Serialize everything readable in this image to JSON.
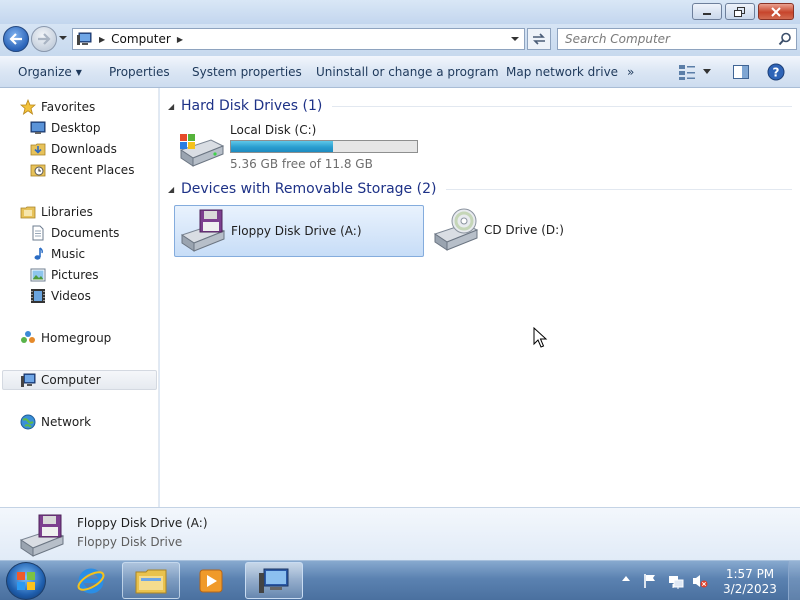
{
  "window": {
    "buttons": [
      "minimize-icon",
      "restore-icon",
      "close-icon"
    ]
  },
  "address": {
    "crumbs": [
      "Computer"
    ],
    "search_placeholder": "Search Computer"
  },
  "toolbar": {
    "organize": "Organize",
    "properties": "Properties",
    "system_properties": "System properties",
    "uninstall": "Uninstall or change a program",
    "map_drive": "Map network drive",
    "more": "»"
  },
  "nav": {
    "favorites": "Favorites",
    "desktop": "Desktop",
    "downloads": "Downloads",
    "recent_places": "Recent Places",
    "libraries": "Libraries",
    "documents": "Documents",
    "music": "Music",
    "pictures": "Pictures",
    "videos": "Videos",
    "homegroup": "Homegroup",
    "computer": "Computer",
    "network": "Network"
  },
  "groups": {
    "hdd_title": "Hard Disk Drives (1)",
    "removable_title": "Devices with Removable Storage (2)"
  },
  "drives": {
    "c_name": "Local Disk (C:)",
    "c_free_text": "5.36 GB free of 11.8 GB",
    "c_used_fraction": 0.546,
    "a_name": "Floppy Disk Drive (A:)",
    "d_name": "CD Drive (D:)"
  },
  "details": {
    "name": "Floppy Disk Drive (A:)",
    "type": "Floppy Disk Drive"
  },
  "taskbar": {
    "time": "1:57 PM",
    "date": "3/2/2023",
    "apps": [
      "internet-explorer-icon",
      "windows-explorer-icon",
      "media-player-icon",
      "computer-window-icon"
    ]
  },
  "colors": {
    "accent": "#1e3287",
    "selection": "#c7ddf7",
    "capacity_fill": "#2a9ecf",
    "taskbar": "#5b82b1"
  }
}
